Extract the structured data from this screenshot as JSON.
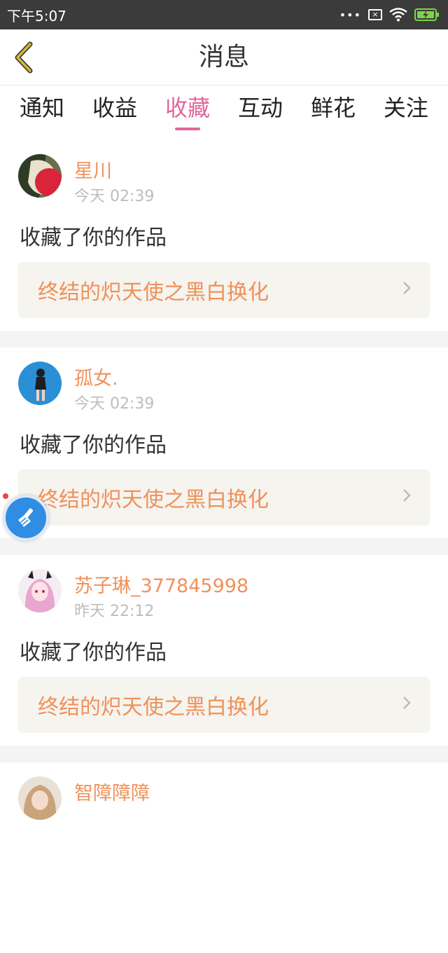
{
  "status_bar": {
    "time": "下午5:07",
    "more_dots": "•••",
    "sim_label": "×"
  },
  "header": {
    "title": "消息"
  },
  "tabs": [
    {
      "label": "通知",
      "active": false
    },
    {
      "label": "收益",
      "active": false
    },
    {
      "label": "收藏",
      "active": true
    },
    {
      "label": "互动",
      "active": false
    },
    {
      "label": "鲜花",
      "active": false
    },
    {
      "label": "关注",
      "active": false
    }
  ],
  "feed": [
    {
      "user": "星川",
      "time": "今天 02:39",
      "action": "收藏了你的作品",
      "work": "终结的炽天使之黑白换化"
    },
    {
      "user": "孤女.",
      "time": "今天 02:39",
      "action": "收藏了你的作品",
      "work": "终结的炽天使之黑白换化"
    },
    {
      "user": "苏子琳_377845998",
      "time": "昨天 22:12",
      "action": "收藏了你的作品",
      "work": "终结的炽天使之黑白换化"
    },
    {
      "user": "智障障障",
      "time": "",
      "action": "",
      "work": ""
    }
  ],
  "colors": {
    "accent_pink": "#e0679a",
    "accent_orange": "#f0915a",
    "header_back_yellow": "#d8b832"
  }
}
